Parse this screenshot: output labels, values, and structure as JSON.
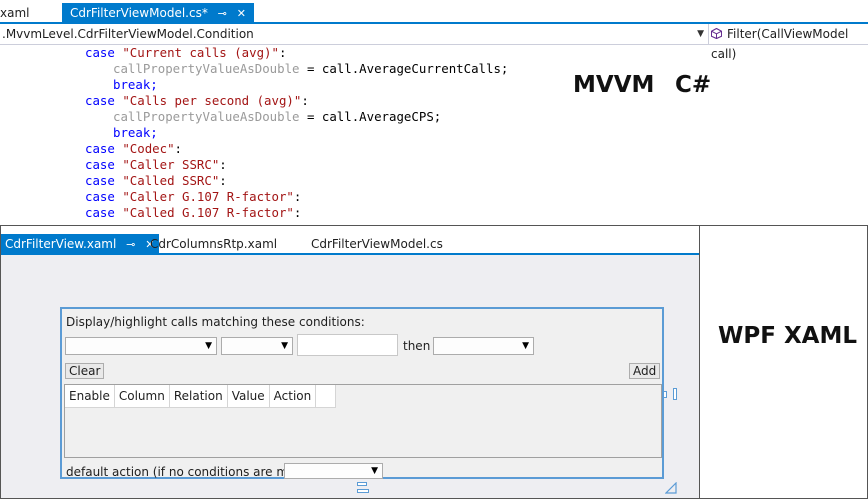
{
  "editor": {
    "tabs": [
      {
        "label": "xaml",
        "active": false
      },
      {
        "label": "CdrFilterViewModel.cs*",
        "active": true,
        "pin": "⊸",
        "close": "✕"
      }
    ],
    "nav_left": ".MvvmLevel.CdrFilterViewModel.Condition",
    "nav_right": "Filter(CallViewModel call)",
    "code": {
      "case": "case",
      "break": "break;",
      "l1_str": "\"Current calls (avg)\"",
      "colon": ":",
      "l2_var": "callPropertyValueAsDouble",
      "l2_rest": " = call.AverageCurrentCalls;",
      "l4_str": "\"Calls per second (avg)\"",
      "l5_rest": " = call.AverageCPS;",
      "l7_str": "\"Codec\"",
      "l8_str": "\"Caller SSRC\"",
      "l9_str": "\"Called SSRC\"",
      "l10_str": "\"Caller G.107 R-factor\"",
      "l11_str": "\"Called G.107 R-factor\""
    }
  },
  "captions": {
    "mvvm": "MVVM",
    "csharp": "C#",
    "wpf": "WPF XAML"
  },
  "designer": {
    "tabs": [
      {
        "label": "CdrFilterView.xaml",
        "active": true,
        "pin": "⊸",
        "close": "✕"
      },
      {
        "label": "CdrColumnsRtp.xaml",
        "active": false
      },
      {
        "label": "CdrFilterViewModel.cs",
        "active": false
      }
    ],
    "panel": {
      "title": "Display/highlight calls matching these conditions:",
      "then_label": "then",
      "clear_button": "Clear",
      "add_button": "Add",
      "columns": [
        "Enable",
        "Column",
        "Relation",
        "Value",
        "Action"
      ],
      "default_action_label": "default action (if no conditions are met):"
    }
  },
  "colors": {
    "accent": "#007acc",
    "keyword": "#0000ff",
    "string": "#a31515",
    "selection_border": "#5b9bd5"
  }
}
